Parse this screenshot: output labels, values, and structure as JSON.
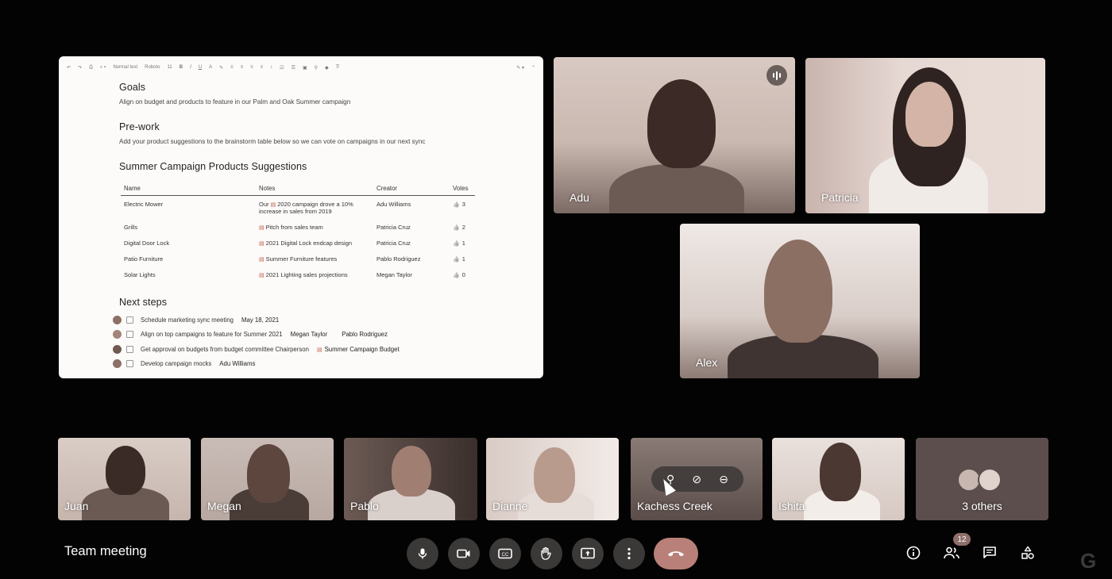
{
  "doc": {
    "toolbar": {
      "style": "Normal text",
      "font": "Roboto",
      "size": "11"
    },
    "goals": {
      "heading": "Goals",
      "text": "Align on budget and products to feature in our Palm and Oak Summer campaign"
    },
    "prework": {
      "heading": "Pre-work",
      "text": "Add your product suggestions to the brainstorm table below so we can vote on campaigns in our next sync"
    },
    "suggestions": {
      "heading": "Summer Campaign Products Suggestions",
      "columns": [
        "Name",
        "Notes",
        "Creator",
        "Votes"
      ],
      "rows": [
        {
          "name": "Electric Mower",
          "note_pre": "Our",
          "note_chip": "2020 campaign",
          "note_post": "drove a 10% increase in sales from 2019",
          "creator": "Adu Williams",
          "votes": "3"
        },
        {
          "name": "Grills",
          "note_pre": "",
          "note_chip": "Pitch from sales team",
          "note_post": "",
          "creator": "Patricia Cruz",
          "votes": "2"
        },
        {
          "name": "Digital Door Lock",
          "note_pre": "",
          "note_chip": "2021 Digital Lock endcap design",
          "note_post": "",
          "creator": "Patricia Cruz",
          "votes": "1"
        },
        {
          "name": "Patio Furniture",
          "note_pre": "",
          "note_chip": "Summer Furniture features",
          "note_post": "",
          "creator": "Pablo Rodriguez",
          "votes": "1"
        },
        {
          "name": "Solar Lights",
          "note_pre": "",
          "note_chip": "2021 Lighting sales projections",
          "note_post": "",
          "creator": "Megan Taylor",
          "votes": "0"
        }
      ]
    },
    "next_steps": {
      "heading": "Next steps",
      "items": [
        {
          "text": "Schedule marketing sync meeting",
          "tags": [
            "May 18, 2021"
          ],
          "doc_tag": ""
        },
        {
          "text": "Align on top campaigns to feature for Summer 2021",
          "tags": [
            "Megan Taylor",
            "Pablo Rodriguez"
          ],
          "doc_tag": ""
        },
        {
          "text": "Get approval on budgets from budget committee Chairperson",
          "tags": [],
          "doc_tag": "Summer Campaign Budget"
        },
        {
          "text": "Develop campaign mocks",
          "tags": [
            "Adu Williams"
          ],
          "doc_tag": ""
        }
      ]
    }
  },
  "main_tiles": [
    {
      "name": "Adu"
    },
    {
      "name": "Patricia"
    },
    {
      "name": "Alex"
    }
  ],
  "strip_tiles": [
    {
      "name": "Juan"
    },
    {
      "name": "Megan"
    },
    {
      "name": "Pablo"
    },
    {
      "name": "Dianne"
    },
    {
      "name": "Kachess Creek"
    },
    {
      "name": "Ishita"
    }
  ],
  "others_label": "3 others",
  "meeting_title": "Team meeting",
  "participants_count": "12",
  "controls": {
    "mic": "mic-icon",
    "camera": "camera-icon",
    "captions": "captions-icon",
    "raise_hand": "raise-hand-icon",
    "present": "present-icon",
    "more": "more-icon",
    "hangup": "hangup-icon"
  },
  "right_icons": [
    "info-icon",
    "people-icon",
    "chat-icon",
    "activities-icon"
  ],
  "colors": {
    "background": "#030303",
    "control_bg": "#3b3838",
    "hangup": "#b98079",
    "badge": "#8e6f6a"
  }
}
